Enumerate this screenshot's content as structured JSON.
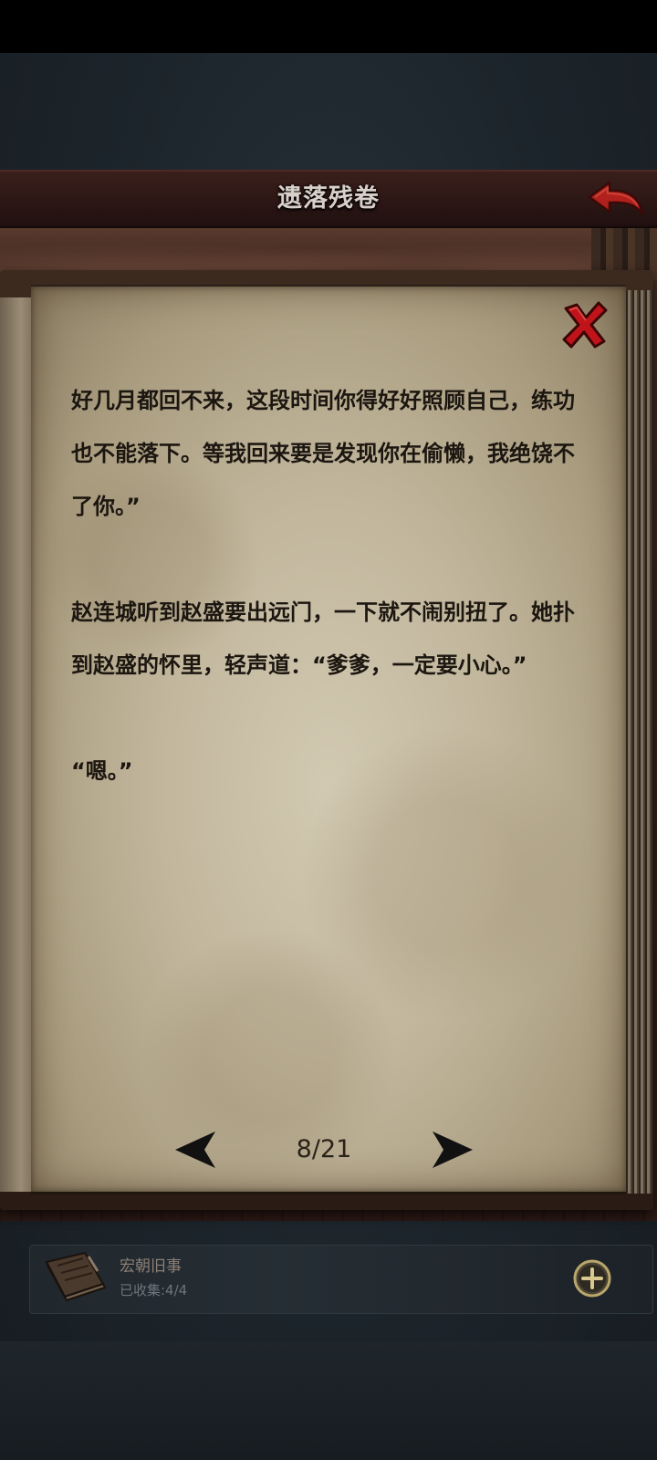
{
  "header": {
    "title": "遗落残卷"
  },
  "reader": {
    "paragraphs": [
      "好几月都回不来，这段时间你得好好照顾自己，练功也不能落下。等我回来要是发现你在偷懒，我绝饶不了你。”",
      "赵连城听到赵盛要出远门，一下就不闹别扭了。她扑到赵盛的怀里，轻声道：“爹爹，一定要小心。”",
      "“嗯。”"
    ],
    "page_indicator": "8/21"
  },
  "collection": {
    "title": "宏朝旧事",
    "count_label": "已收集:4/4"
  },
  "icons": {
    "back": "back-arrow-icon",
    "close": "close-x-icon",
    "prev": "triangle-left-icon",
    "next": "triangle-right-icon",
    "book": "book-icon",
    "add": "plus-circle-icon"
  },
  "colors": {
    "close_red": "#c0141a",
    "back_red": "#b0201c",
    "page_text": "#1c1610"
  }
}
